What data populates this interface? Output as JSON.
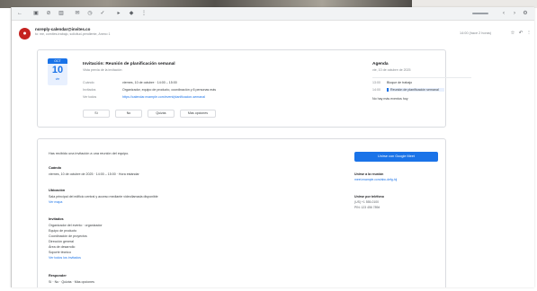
{
  "colors": {
    "accent": "#1a73e8",
    "avatar": "#c5221f",
    "toolbar": "#f1f3f4",
    "border": "#dadce0"
  },
  "toolbar": {
    "icons": [
      "back-arrow-icon",
      "archive-icon",
      "report-icon",
      "delete-icon",
      "mark-unread-icon",
      "snooze-icon",
      "add-task-icon",
      "move-to-icon",
      "label-icon",
      "more-icon"
    ]
  },
  "header": {
    "sender": "noreply-calendar@invites.co",
    "sender_sub": "to: me, comites-trabajo, solicitud-pendiente, Anexo 1",
    "date": "14:00 (hace 2 horas)",
    "icons": [
      "star-icon",
      "reply-icon",
      "more-vert-icon"
    ]
  },
  "invite": {
    "badge": {
      "month": "OCT",
      "day": "10",
      "weekday": "vie"
    },
    "title": "Invitación: Reunión de planificación semanal",
    "subtitle": "Vista previa de la invitación",
    "rows": [
      {
        "label": "Cuándo",
        "value": "viernes, 10 de octubre · 14:00 – 15:00"
      },
      {
        "label": "Invitados",
        "value": "Organizador, equipo de producto, coordinación y 8 personas más"
      },
      {
        "label": "Ver todos",
        "value": "https://calendar.example.com/event/planificacion-semanal"
      }
    ],
    "rsvp": [
      "Sí",
      "No",
      "Quizás",
      "Más opciones"
    ]
  },
  "agenda": {
    "title": "Agenda",
    "subtitle": "vie, 10 de octubre de 2025",
    "events": [
      {
        "time": "13:00",
        "name": "Bloque de trabajo"
      },
      {
        "time": "14:00",
        "name": "Reunión de planificación semanal"
      },
      {
        "time": "",
        "name": "No hay más eventos hoy"
      }
    ]
  },
  "body": {
    "intro": "Has recibido una invitación a una reunión del equipo.",
    "when_h": "Cuándo",
    "when_t": "viernes, 10 de octubre de 2025 · 14:00 – 15:00 · Hora estándar",
    "where_h": "Ubicación",
    "where_t": "Sala principal del edificio central y acceso mediante videollamada disponible",
    "where_link": "Ver mapa",
    "guests_h": "Invitados",
    "guests": [
      "Organizador del evento · organizador",
      "Equipo de producto",
      "Coordinación de proyectos",
      "Dirección general",
      "Área de desarrollo",
      "Soporte técnico",
      "Ver todos los invitados"
    ],
    "reply_h": "Responder",
    "reply_t": "Sí · No · Quizás · Más opciones",
    "join_btn": "Unirse con Google Meet",
    "side": {
      "h1": "Unirse a la reunión",
      "t1": "meet.example.com/abc-defg-hij",
      "h2": "Unirse por teléfono",
      "t2": "(US) +1 555-0100",
      "t3": "PIN: 123 456 789#"
    }
  }
}
